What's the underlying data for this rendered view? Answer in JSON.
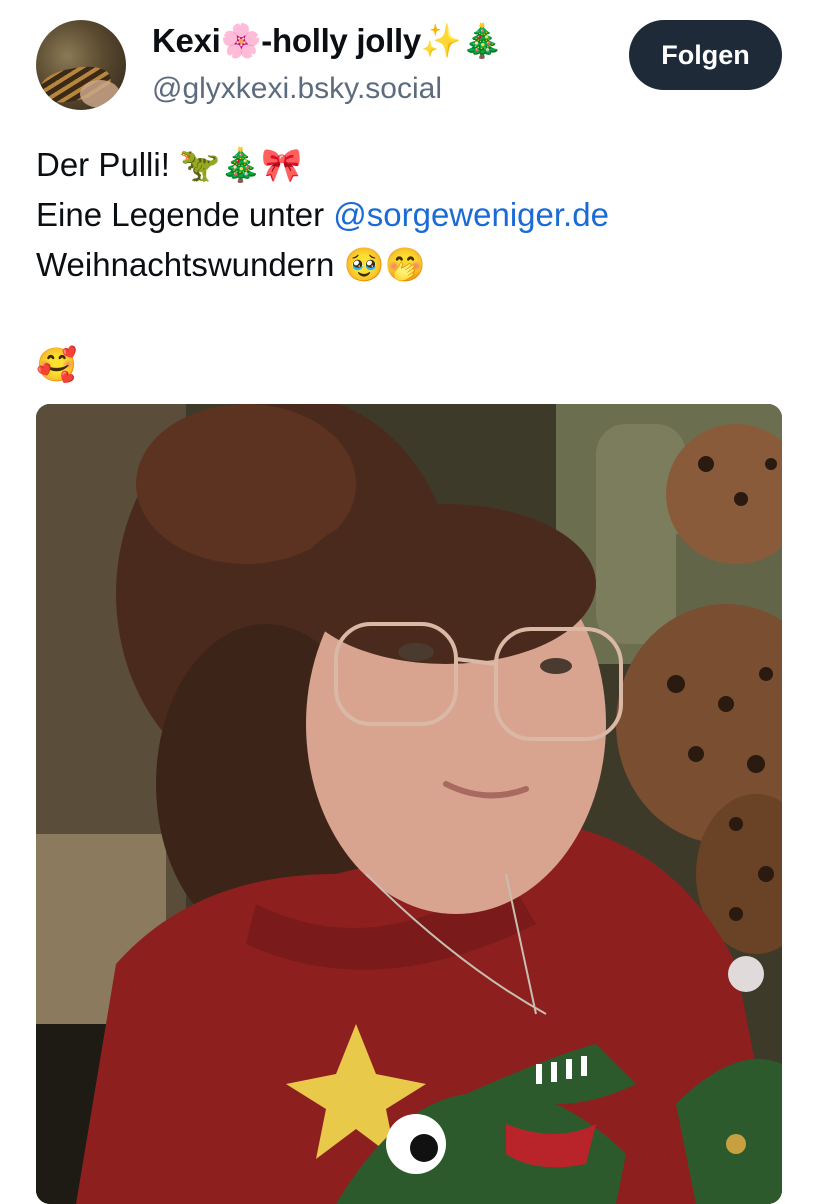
{
  "author": {
    "display_name": "Kexi🌸-holly jolly✨🎄",
    "handle": "@glyxkexi.bsky.social",
    "avatar_icon": "avatar-photo"
  },
  "follow_button": {
    "label": "Folgen",
    "bg_color": "#1e2a38",
    "text_color": "#ffffff"
  },
  "post": {
    "line1": "Der Pulli! 🦖🎄🎀",
    "line2_prefix": "Eine Legende unter ",
    "line2_mention": "@sorgeweniger.de",
    "line3": "Weihnachtswundern 🥹🤭",
    "line4": "🥰",
    "mention_color": "#1b6bd6"
  },
  "image": {
    "icon": "photo-selfie"
  }
}
